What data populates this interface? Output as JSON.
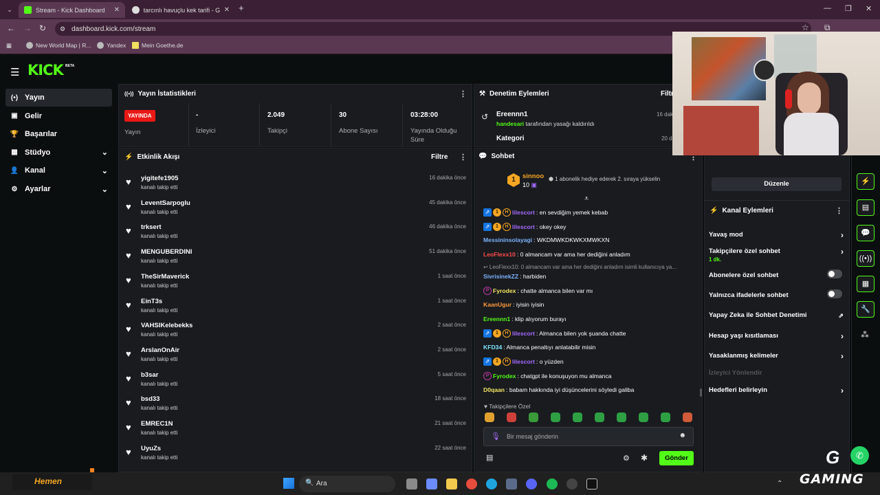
{
  "browser": {
    "tabs": [
      {
        "title": "Stream - Kick Dashboard",
        "active": true
      },
      {
        "title": "tarcınlı havuçlu kek tarifi - Goo",
        "active": false
      }
    ],
    "new_tab": "+",
    "url": "dashboard.kick.com/stream",
    "bookmarks": [
      "New World Map | R...",
      "Yandex",
      "Mein Goethe.de"
    ]
  },
  "app": {
    "logo": "KICK",
    "beta": "BETA",
    "sidebar": [
      {
        "label": "Yayın",
        "icon": "(•)",
        "active": true,
        "expand": false
      },
      {
        "label": "Gelir",
        "icon": "▣",
        "active": false,
        "expand": false
      },
      {
        "label": "Başarılar",
        "icon": "🏆",
        "active": false,
        "expand": false
      },
      {
        "label": "Stüdyo",
        "icon": "▦",
        "active": false,
        "expand": true
      },
      {
        "label": "Kanal",
        "icon": "👤",
        "active": false,
        "expand": true
      },
      {
        "label": "Ayarlar",
        "icon": "⚙",
        "active": false,
        "expand": true
      }
    ]
  },
  "stats": {
    "title": "Yayın İstatistikleri",
    "live_badge": "YAYINDA",
    "items": [
      {
        "value": "",
        "label": "Yayın"
      },
      {
        "value": "-",
        "label": "İzleyici"
      },
      {
        "value": "2.049",
        "label": "Takipçi"
      },
      {
        "value": "30",
        "label": "Abone Sayısı"
      },
      {
        "value": "03:28:00",
        "label": "Yayında Olduğu Süre"
      }
    ]
  },
  "moderation": {
    "title": "Denetim Eylemleri",
    "filter": "Filtr",
    "entries": [
      {
        "user": "Ereennn1",
        "by": "handesari",
        "text": "tarafından yasağı kaldırıldı",
        "time": "16 dak"
      },
      {
        "user": "Kategori",
        "time": "20 d"
      }
    ]
  },
  "activity": {
    "title": "Etkinlik Akışı",
    "filter": "Filtre",
    "items": [
      {
        "name": "yigitefe1905",
        "sub": "kanalı takip etti",
        "time": "16 dakika önce"
      },
      {
        "name": "LeventSarpoglu",
        "sub": "kanalı takip etti",
        "time": "45 dakika önce"
      },
      {
        "name": "trksert",
        "sub": "kanalı takip etti",
        "time": "46 dakika önce"
      },
      {
        "name": "MENGUBERDINI",
        "sub": "kanalı takip etti",
        "time": "51 dakika önce"
      },
      {
        "name": "TheSirMaverick",
        "sub": "kanalı takip etti",
        "time": "1 saat önce"
      },
      {
        "name": "EinT3s",
        "sub": "kanalı takip etti",
        "time": "1 saat önce"
      },
      {
        "name": "VAHSIKelebekks",
        "sub": "kanalı takip etti",
        "time": "2 saat önce"
      },
      {
        "name": "ArslanOnAir",
        "sub": "kanalı takip etti",
        "time": "2 saat önce"
      },
      {
        "name": "b3sar",
        "sub": "kanalı takip etti",
        "time": "5 saat önce"
      },
      {
        "name": "bsd33",
        "sub": "kanalı takip etti",
        "time": "18 saat önce"
      },
      {
        "name": "EMREC1N",
        "sub": "kanalı takip etti",
        "time": "21 saat önce"
      },
      {
        "name": "UyuZs",
        "sub": "kanalı takip etti",
        "time": "22 saat önce"
      }
    ]
  },
  "chat": {
    "title": "Sohbet",
    "pinned_user": "sinnoo",
    "pinned_count": "10",
    "pinned_text": "1 abonelik hediye ederek 2. sıraya yükselin",
    "messages": [
      {
        "badges": [
          "vip",
          "gold",
          "h"
        ],
        "user": "lilescort",
        "color": "#a56bff",
        "text": ": en sevdiğim yemek kebab"
      },
      {
        "badges": [
          "vip",
          "gold",
          "h"
        ],
        "user": "lilescort",
        "color": "#a56bff",
        "text": ": okey okey"
      },
      {
        "badges": [],
        "user": "Messininsolayagi",
        "color": "#7db3ff",
        "text": ": WKDMWKDKWKXMWKXN"
      },
      {
        "badges": [],
        "user": "LeoFlexx10",
        "color": "#ff4c4c",
        "text": ": 0 almancam var ama her dediğini anladım"
      },
      {
        "badges": [],
        "user": "",
        "color": "#9a9a9a",
        "text": "↩ LeoFlexx10: 0 almancam var ama her dediğini anladım isimli kullanıcıya ya..."
      },
      {
        "badges": [],
        "user": "SivrisinekZZ",
        "color": "#7db3ff",
        "text": ": harbiden"
      },
      {
        "badges": [
          "p"
        ],
        "user": "Fyrodex",
        "color": "#f5e663",
        "text": ": chatte almanca bilen var mı"
      },
      {
        "badges": [],
        "user": "KaanUgur",
        "color": "#ff9a3d",
        "text": ": iyisin iyisin"
      },
      {
        "badges": [],
        "user": "Ereennn1",
        "color": "#53fc18",
        "text": ": klip alıyorum burayı"
      },
      {
        "badges": [
          "vip",
          "gold",
          "h"
        ],
        "user": "lilescort",
        "color": "#a56bff",
        "text": ": Almanca bilen yok şuanda chatte"
      },
      {
        "badges": [],
        "user": "KFD34",
        "color": "#7ee7ff",
        "text": ": Almanca penaltıyı anlatabilir misin"
      },
      {
        "badges": [
          "vip",
          "gold",
          "h"
        ],
        "user": "lilescort",
        "color": "#a56bff",
        "text": ": o yüzden"
      },
      {
        "badges": [
          "p"
        ],
        "user": "Fyrodex",
        "color": "#53fc18",
        "text": ": chatgpt ile konuşuyon mu almanca"
      },
      {
        "badges": [],
        "user": "D0qaan",
        "color": "#f5e663",
        "text": ": babam hakkında iyi düşüncelerini söyledi galiba"
      }
    ],
    "followers_only": "Takipçilere Özel",
    "input_placeholder": "Bir mesaj gönderin",
    "send": "Gönder"
  },
  "right_panel": {
    "edit_button": "Düzenle",
    "title": "Kanal Eylemleri",
    "items": [
      {
        "label": "Yavaş mod",
        "type": "arrow"
      },
      {
        "label": "Takipçilere özel sohbet",
        "sub": "1 dk.",
        "type": "arrow"
      },
      {
        "label": "Abonelere özel sohbet",
        "type": "toggle"
      },
      {
        "label": "Yalnızca ifadelerle sohbet",
        "type": "toggle"
      },
      {
        "label": "Yapay Zeka ile Sohbet Denetimi",
        "type": "external"
      },
      {
        "label": "Hesap yaşı kısıtlaması",
        "type": "arrow"
      },
      {
        "label": "Yasaklanmış kelimeler",
        "type": "arrow"
      },
      {
        "label": "İzleyici Yönlendir",
        "type": "disabled"
      },
      {
        "label": "Hedefleri belirleyin",
        "type": "arrow"
      }
    ]
  },
  "taskbar": {
    "search": "Ara",
    "hemen": "Hemen",
    "gaming": "GAMING"
  }
}
